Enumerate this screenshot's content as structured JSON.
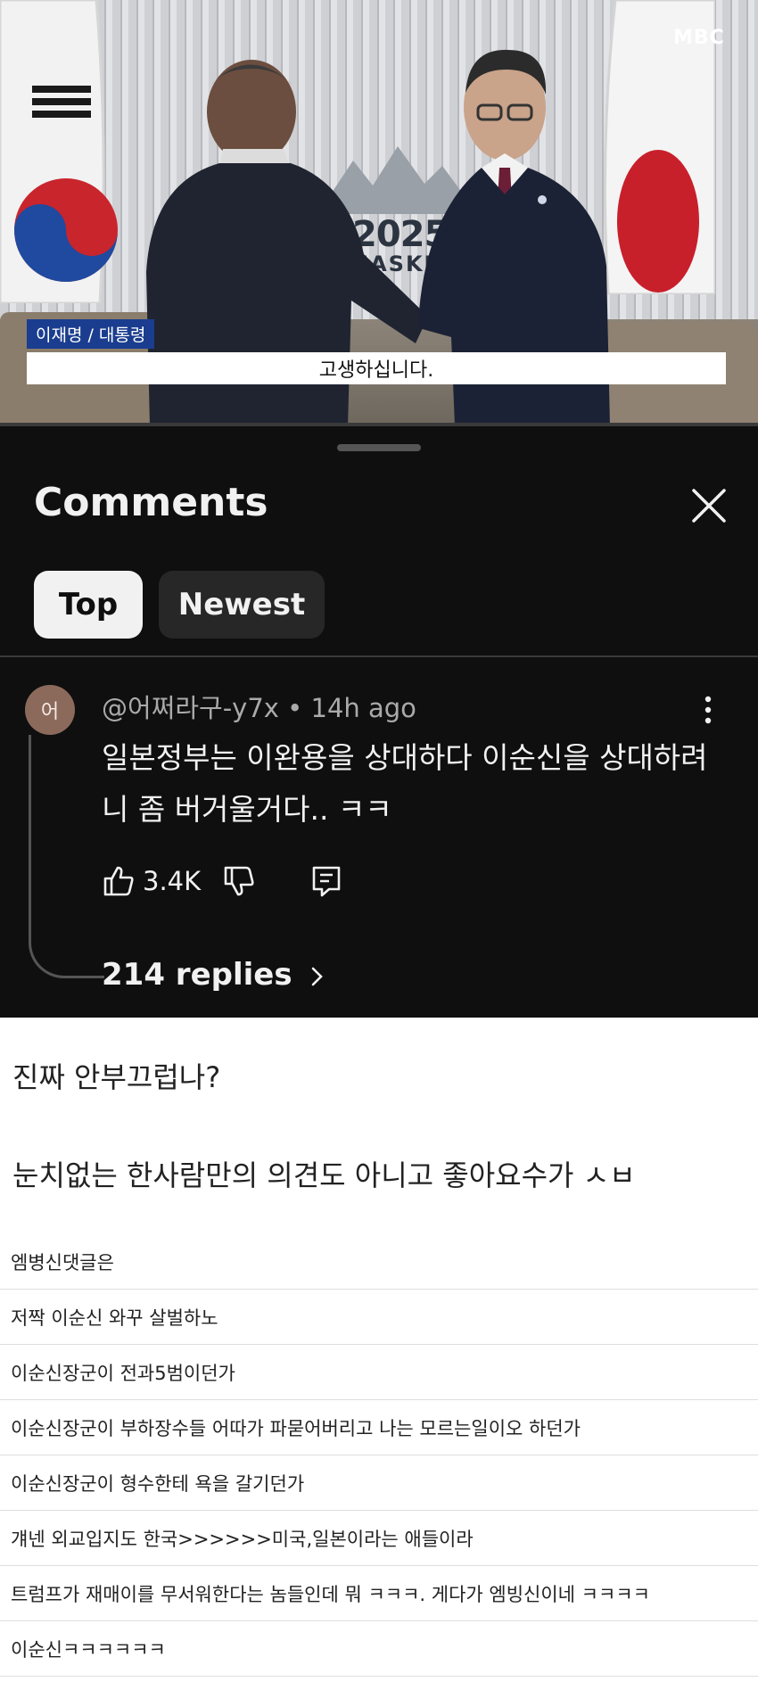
{
  "video": {
    "channel_logo": "MBC",
    "name_caption": "이재명 / 대통령",
    "subtitle": "고생하십니다.",
    "backdrop_logo_year": "2025",
    "backdrop_logo_word": "NASKI",
    "progress_fraction": 0.0
  },
  "comments_panel": {
    "title": "Comments",
    "close_icon": "close-icon",
    "tabs": [
      {
        "label": "Top",
        "selected": true
      },
      {
        "label": "Newest",
        "selected": false
      }
    ],
    "comment": {
      "avatar_initial": "어",
      "author": "@어쩌라구-y7x",
      "time": "14h ago",
      "meta": "@어쩌라구-y7x • 14h ago",
      "text": "일본정부는 이완용을 상대하다 이순신을 상대하려니 좀 버거울거다.. ㅋㅋ",
      "likes": "3.4K",
      "replies": "214 replies"
    },
    "colors": {
      "panel_bg": "#0f0f0f",
      "chip_selected": "#f1f1f1",
      "chip_unselected": "#272727"
    }
  },
  "notes": [
    "진짜 안부끄럽나?",
    "눈치없는 한사람만의 의견도 아니고 좋아요수가 ㅅㅂ"
  ],
  "replies_list": [
    "엠병신댓글은",
    "저짝 이순신 와꾸 살벌하노",
    "이순신장군이 전과5범이던가",
    "이순신장군이 부하장수들 어따가 파묻어버리고 나는 모르는일이오 하던가",
    "이순신장군이 형수한테 욕을 갈기던가",
    "걔넨 외교입지도 한국>>>>>>미국,일본이라는 애들이라",
    "트럼프가 재매이를 무서워한다는 놈들인데 뭐 ㅋㅋㅋ. 게다가 엠빙신이네 ㅋㅋㅋㅋ",
    "이순신ㅋㅋㅋㅋㅋㅋ"
  ]
}
